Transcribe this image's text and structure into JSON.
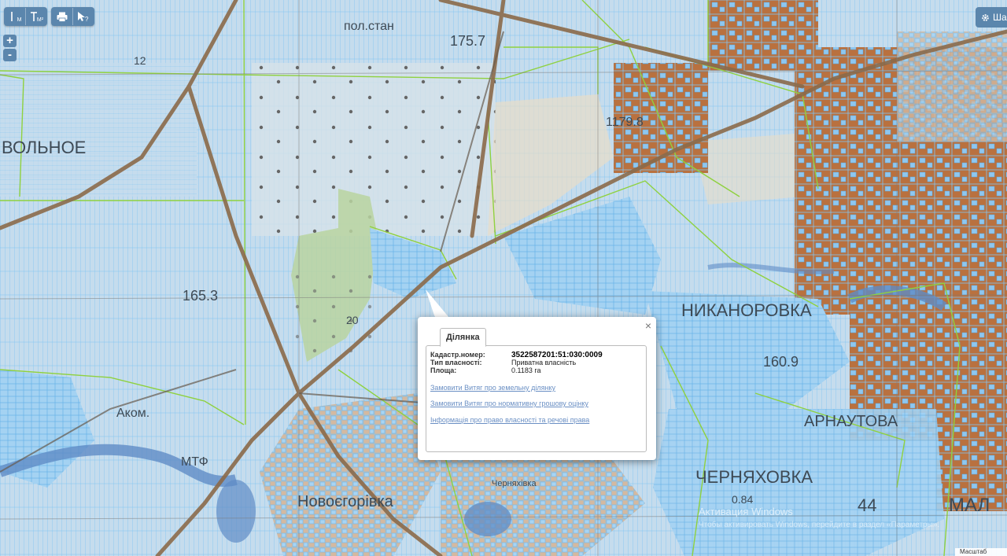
{
  "toolbar": {
    "measure_line_label": "M",
    "measure_area_label": "M²",
    "print_icon": "printer-icon",
    "identify_icon": "cursor-question-icon"
  },
  "zoom": {
    "in_label": "+",
    "out_label": "-"
  },
  "layers": {
    "label": "Шар",
    "icon": "gear-icon"
  },
  "map_labels": {
    "l1": "пол.стан",
    "l2": "175.7",
    "l3": "ВОЛЬНОЕ",
    "l4": "12",
    "l5": "165.3",
    "l6": "20",
    "l7": "Аком.",
    "l8": "МТФ",
    "l9": "Новоєгорівка",
    "l10": "Черняхівка",
    "l11": "НИКАНОРОВКА",
    "l12": "АРНАУТОВА",
    "l13": "160.9",
    "l14": "ЧЕРНЯХОВКА",
    "l15": "0.84",
    "l16": "44",
    "l17": "МАЛ",
    "l18": "1179.8"
  },
  "popup": {
    "tab_label": "Ділянка",
    "close_label": "×",
    "fields": {
      "cadastral_key": "Кадастр.номер:",
      "cadastral_value": "3522587201:51:030:0009",
      "ownership_key": "Тип власності:",
      "ownership_value": "Приватна власність",
      "area_key": "Площа:",
      "area_value": "0.1183 га"
    },
    "links": {
      "l1": "Замовити Витяг про земельну ділянку",
      "l2": "Замовити Витяг про нормативну грошову оцінку",
      "l3": "Інформація про право власності та речові права"
    }
  },
  "watermark": {
    "title": "Активация Windows",
    "subtitle": "Чтобы активировать Windows, перейдите в раздел «Параметры»."
  },
  "scale_label": "Масштаб",
  "colors": {
    "toolbar_blue": "#5b86ad",
    "parcel_line": "#7fc4f2",
    "boundary_green": "#8fd13f",
    "road_brown": "#8b6a4a",
    "urban_brown": "#b9713f",
    "link_blue": "#6a8fc4"
  }
}
